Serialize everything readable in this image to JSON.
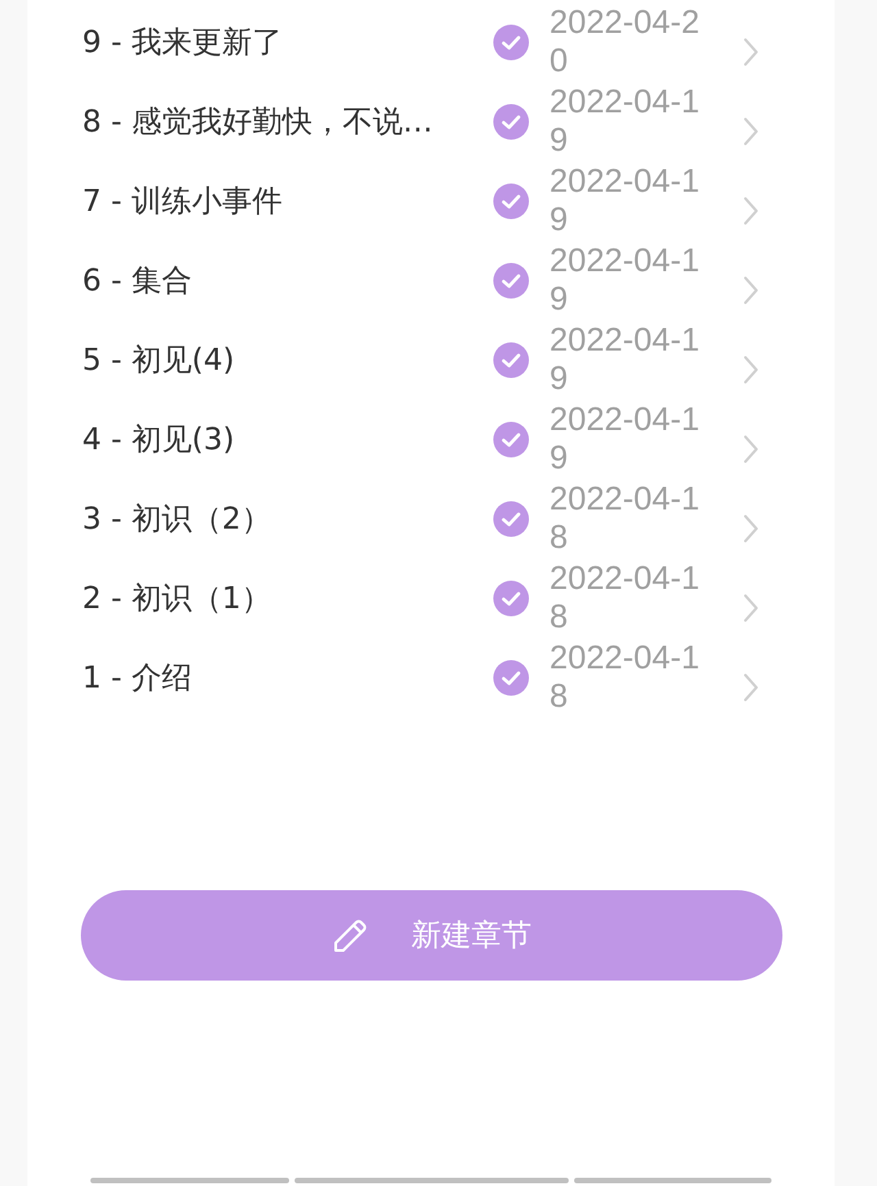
{
  "chapters": [
    {
      "title": "9 - 我来更新了",
      "done": true,
      "date": "2022-04-20"
    },
    {
      "title": "8 - 感觉我好勤快，不说…",
      "done": true,
      "date": "2022-04-19"
    },
    {
      "title": "7 - 训练小事件",
      "done": true,
      "date": "2022-04-19"
    },
    {
      "title": "6 - 集合",
      "done": true,
      "date": "2022-04-19"
    },
    {
      "title": "5 - 初见(4)",
      "done": true,
      "date": "2022-04-19"
    },
    {
      "title": "4 - 初见(3)",
      "done": true,
      "date": "2022-04-19"
    },
    {
      "title": "3 - 初识（2）",
      "done": true,
      "date": "2022-04-18"
    },
    {
      "title": "2 - 初识（1）",
      "done": true,
      "date": "2022-04-18"
    },
    {
      "title": "1 - 介绍",
      "done": true,
      "date": "2022-04-18"
    }
  ],
  "new_chapter_button": {
    "label": "新建章节"
  }
}
